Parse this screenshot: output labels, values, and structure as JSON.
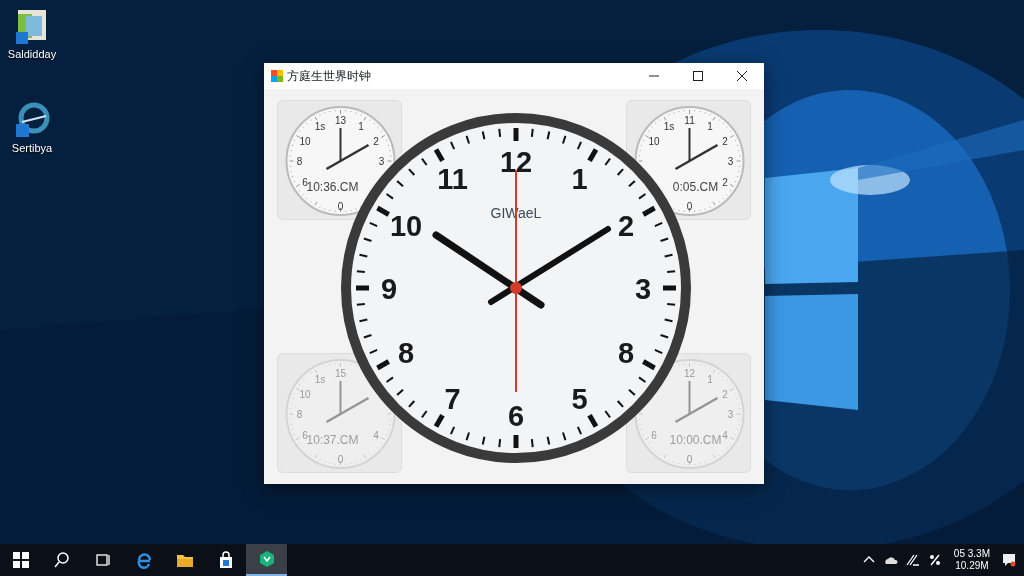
{
  "desktop_icons": [
    {
      "kind": "notes",
      "label": "Saldidday"
    },
    {
      "kind": "browser",
      "label": "Sertibya"
    }
  ],
  "window": {
    "title": "方庭生世界时钟"
  },
  "main_clock": {
    "brand": "GIWaeL",
    "numerals": [
      "12",
      "1",
      "2",
      "3",
      "8",
      "5",
      "6",
      "7",
      "8",
      "9",
      "10",
      "11"
    ]
  },
  "mini_clocks": [
    {
      "faded": false,
      "time": "10:36.CM",
      "numerals": {
        "h11": "1s",
        "h12": "13",
        "h1": "1",
        "h10": "10",
        "h2": "2",
        "h9": "8",
        "h3": "3",
        "h8": "6",
        "h6": "0"
      }
    },
    {
      "faded": false,
      "time": "0:05.CM",
      "numerals": {
        "h11": "1s",
        "h12": "11",
        "h1": "1",
        "h10": "10",
        "h2": "2",
        "h3": "3",
        "h4": "2",
        "h6": "0"
      }
    },
    {
      "faded": true,
      "time": "10:37.CM",
      "numerals": {
        "h11": "1s",
        "h12": "15",
        "h10": "10",
        "h9": "8",
        "h8": "6",
        "h4": "4",
        "h6": "0"
      }
    },
    {
      "faded": true,
      "time": "10:00.CM",
      "numerals": {
        "h12": "12",
        "h1": "1",
        "h2": "2",
        "h3": "3",
        "h8": "6",
        "h4": "4",
        "h6": "0"
      }
    }
  ],
  "taskbar": {
    "items": [
      {
        "kind": "start",
        "selected": false
      },
      {
        "kind": "search",
        "selected": false
      },
      {
        "kind": "taskview",
        "selected": false
      },
      {
        "kind": "edge",
        "selected": false
      },
      {
        "kind": "folder",
        "selected": false
      },
      {
        "kind": "store",
        "selected": false
      },
      {
        "kind": "app",
        "selected": true
      }
    ],
    "tray": {
      "clock_lines": [
        "05 3.3M",
        "10.29M"
      ]
    }
  }
}
